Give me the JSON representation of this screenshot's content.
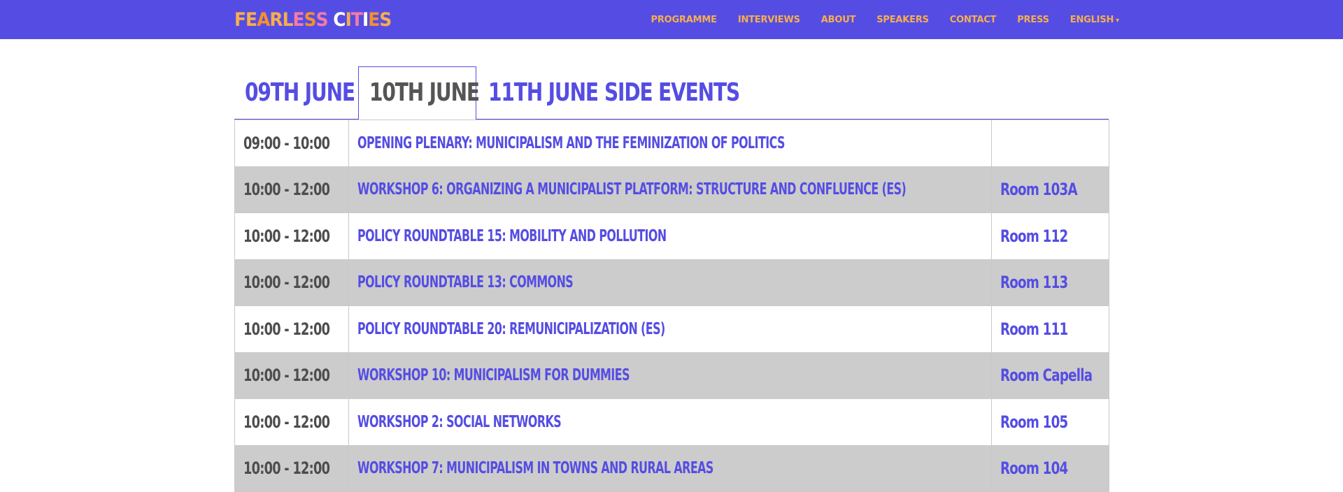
{
  "header": {
    "logo_letters": [
      {
        "ch": "F",
        "color": "#f7ae4d"
      },
      {
        "ch": "E",
        "color": "#f7ae4d"
      },
      {
        "ch": "A",
        "color": "#f5902e"
      },
      {
        "ch": "R",
        "color": "#f7ae4d"
      },
      {
        "ch": "L",
        "color": "#f7ae4d"
      },
      {
        "ch": "E",
        "color": "#f37ba8"
      },
      {
        "ch": "S",
        "color": "#f5902e"
      },
      {
        "ch": "S",
        "color": "#f37ba8"
      },
      {
        "ch": " ",
        "color": "#ffffff"
      },
      {
        "ch": "C",
        "color": "#ffffff"
      },
      {
        "ch": "I",
        "color": "#f7ae4d"
      },
      {
        "ch": "T",
        "color": "#f37ba8"
      },
      {
        "ch": "I",
        "color": "#ffffff"
      },
      {
        "ch": "E",
        "color": "#f5902e"
      },
      {
        "ch": "S",
        "color": "#f7ae4d"
      }
    ],
    "nav": [
      "PROGRAMME",
      "INTERVIEWS",
      "ABOUT",
      "SPEAKERS",
      "CONTACT",
      "PRESS"
    ],
    "language": "ENGLISH",
    "caret": "▾",
    "colors": {
      "bar": "#554de3",
      "nav_text": "#f7ae4d"
    }
  },
  "tabs": [
    {
      "label": "09TH JUNE",
      "active": false
    },
    {
      "label": "10TH JUNE",
      "active": true
    },
    {
      "label": "11TH JUNE",
      "active": false
    },
    {
      "label": "SIDE EVENTS",
      "active": false
    }
  ],
  "schedule": [
    {
      "time": "09:00 - 10:00",
      "event": "OPENING PLENARY: MUNICIPALISM AND THE FEMINIZATION OF POLITICS",
      "room": ""
    },
    {
      "time": "10:00 - 12:00",
      "event": "WORKSHOP 6: ORGANIZING A MUNICIPALIST PLATFORM: STRUCTURE AND CONFLUENCE (ES)",
      "room": "Room 103A"
    },
    {
      "time": "10:00 - 12:00",
      "event": "POLICY ROUNDTABLE 15: MOBILITY AND POLLUTION",
      "room": "Room 112"
    },
    {
      "time": "10:00 - 12:00",
      "event": "POLICY ROUNDTABLE 13: COMMONS",
      "room": "Room 113"
    },
    {
      "time": "10:00 - 12:00",
      "event": "POLICY ROUNDTABLE 20: REMUNICIPALIZATION (ES)",
      "room": "Room 111"
    },
    {
      "time": "10:00 - 12:00",
      "event": "WORKSHOP 10: MUNICIPALISM FOR DUMMIES",
      "room": "Room Capella"
    },
    {
      "time": "10:00 - 12:00",
      "event": "WORKSHOP 2: SOCIAL NETWORKS",
      "room": "Room 105"
    },
    {
      "time": "10:00 - 12:00",
      "event": "WORKSHOP 7: MUNICIPALISM IN TOWNS AND RURAL AREAS",
      "room": "Room 104"
    }
  ]
}
